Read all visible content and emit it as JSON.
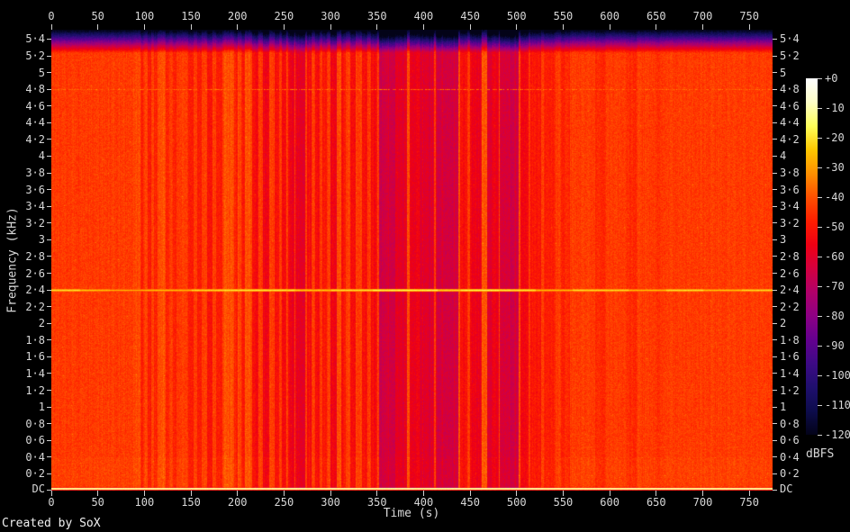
{
  "credit": "Created by SoX",
  "axes": {
    "x_label": "Time (s)",
    "y_label": "Frequency (kHz)",
    "colorbar_label": "dBFS"
  },
  "chart_data": {
    "type": "heatmap",
    "subtype": "audio-spectrogram",
    "title": "",
    "x_axis": {
      "label": "Time (s)",
      "tick_values": [
        0,
        50,
        100,
        150,
        200,
        250,
        300,
        350,
        400,
        450,
        500,
        550,
        600,
        650,
        700,
        750
      ],
      "tick_labels": [
        "0",
        "50",
        "100",
        "150",
        "200",
        "250",
        "300",
        "350",
        "400",
        "450",
        "500",
        "550",
        "600",
        "650",
        "700",
        "750"
      ],
      "range": [
        0,
        775
      ]
    },
    "y_axis": {
      "label": "Frequency (kHz)",
      "tick_values": [
        0,
        0.2,
        0.4,
        0.6,
        0.8,
        1,
        1.2,
        1.4,
        1.6,
        1.8,
        2,
        2.2,
        2.4,
        2.6,
        2.8,
        3,
        3.2,
        3.4,
        3.6,
        3.8,
        4,
        4.2,
        4.4,
        4.6,
        4.8,
        5,
        5.2,
        5.4
      ],
      "tick_labels": [
        "DC",
        "0·2",
        "0·4",
        "0·6",
        "0·8",
        "1",
        "1·2",
        "1·4",
        "1·6",
        "1·8",
        "2",
        "2·2",
        "2·4",
        "2·6",
        "2·8",
        "3",
        "3·2",
        "3·4",
        "3·6",
        "3·8",
        "4",
        "4·2",
        "4·4",
        "4·6",
        "4·8",
        "5",
        "5·2",
        "5·4"
      ],
      "range": [
        0,
        5.5125
      ],
      "mirrored_right": true
    },
    "colorbar": {
      "label": "dBFS",
      "tick_labels": [
        "+0",
        "-10",
        "-20",
        "-30",
        "-40",
        "-50",
        "-60",
        "-70",
        "-80",
        "-90",
        "-100",
        "-110",
        "-120"
      ],
      "range_db": [
        0,
        -120
      ],
      "colormap": [
        [
          0,
          "#ffffff"
        ],
        [
          -8,
          "#ffffc8"
        ],
        [
          -16,
          "#ffff5a"
        ],
        [
          -24,
          "#ffc800"
        ],
        [
          -32,
          "#ff9000"
        ],
        [
          -40,
          "#ff5000"
        ],
        [
          -48,
          "#ff1e00"
        ],
        [
          -56,
          "#ef0013"
        ],
        [
          -64,
          "#d3003f"
        ],
        [
          -72,
          "#b00069"
        ],
        [
          -80,
          "#8d0084"
        ],
        [
          -88,
          "#64008f"
        ],
        [
          -96,
          "#3d0a86"
        ],
        [
          -104,
          "#1f0f6e"
        ],
        [
          -112,
          "#0d0c4c"
        ],
        [
          -120,
          "#030318"
        ]
      ]
    },
    "base_level_db": -42.5,
    "noise_db": 7,
    "features": {
      "lowpass_rolloff": {
        "start_khz": 5.24,
        "top_khz": 5.5125,
        "extra_attenuation_db": 78
      },
      "tone_2p4khz": {
        "freq_khz": 2.4,
        "segments": [
          [
            0,
            30,
            -20
          ],
          [
            30,
            62,
            -24
          ],
          [
            62,
            100,
            -27
          ],
          [
            100,
            150,
            -25
          ],
          [
            150,
            185,
            -21
          ],
          [
            185,
            262,
            -19
          ],
          [
            262,
            300,
            -23
          ],
          [
            300,
            345,
            -20
          ],
          [
            345,
            415,
            -17
          ],
          [
            415,
            440,
            -21
          ],
          [
            440,
            480,
            -17
          ],
          [
            480,
            520,
            -19
          ],
          [
            520,
            560,
            -25
          ],
          [
            560,
            620,
            -21
          ],
          [
            620,
            660,
            -25
          ],
          [
            660,
            700,
            -20
          ],
          [
            700,
            742,
            -24
          ],
          [
            742,
            776,
            -21
          ]
        ]
      },
      "tone_4p8khz": {
        "freq_khz": 4.8,
        "level_db": -38,
        "intermittent": true
      },
      "dc_line": {
        "level_db": -13,
        "dark_row_above_db": -6
      }
    },
    "time_bands_db": [
      [
        88,
        95,
        2
      ],
      [
        95,
        99,
        -4
      ],
      [
        100,
        103,
        2
      ],
      [
        103,
        107,
        -5
      ],
      [
        110,
        114,
        -4
      ],
      [
        114,
        121,
        3
      ],
      [
        122,
        126,
        -5
      ],
      [
        130,
        134,
        -4
      ],
      [
        147,
        152,
        -6
      ],
      [
        156,
        161,
        -5
      ],
      [
        167,
        173,
        -8
      ],
      [
        177,
        183,
        -6
      ],
      [
        185,
        196,
        3
      ],
      [
        196,
        200,
        -5
      ],
      [
        200,
        204,
        2
      ],
      [
        204,
        208,
        -6
      ],
      [
        208,
        215,
        3
      ],
      [
        215,
        222,
        -9
      ],
      [
        227,
        234,
        -12
      ],
      [
        239,
        244,
        -8
      ],
      [
        247,
        252,
        -9
      ],
      [
        254,
        261,
        -13
      ],
      [
        262,
        272,
        -16
      ],
      [
        274,
        279,
        -10
      ],
      [
        283,
        288,
        -9
      ],
      [
        291,
        296,
        -8
      ],
      [
        299,
        306,
        -12
      ],
      [
        306,
        311,
        2
      ],
      [
        311,
        316,
        -8
      ],
      [
        321,
        327,
        -10
      ],
      [
        333,
        339,
        -8
      ],
      [
        343,
        350,
        -9
      ],
      [
        352,
        369,
        -20
      ],
      [
        369,
        382,
        -17
      ],
      [
        382,
        385,
        3
      ],
      [
        385,
        395,
        -13
      ],
      [
        395,
        411,
        -16
      ],
      [
        413,
        437,
        -20
      ],
      [
        437,
        439,
        3
      ],
      [
        439,
        447,
        -9
      ],
      [
        449,
        462,
        -13
      ],
      [
        462,
        468,
        4
      ],
      [
        468,
        480,
        -15
      ],
      [
        481,
        502,
        -21
      ],
      [
        502,
        504,
        2
      ],
      [
        504,
        512,
        -11
      ],
      [
        514,
        526,
        -7
      ],
      [
        529,
        541,
        -5
      ],
      [
        547,
        557,
        -4
      ],
      [
        584,
        596,
        -3
      ],
      [
        618,
        628,
        -3
      ],
      [
        648,
        656,
        -2
      ]
    ]
  }
}
